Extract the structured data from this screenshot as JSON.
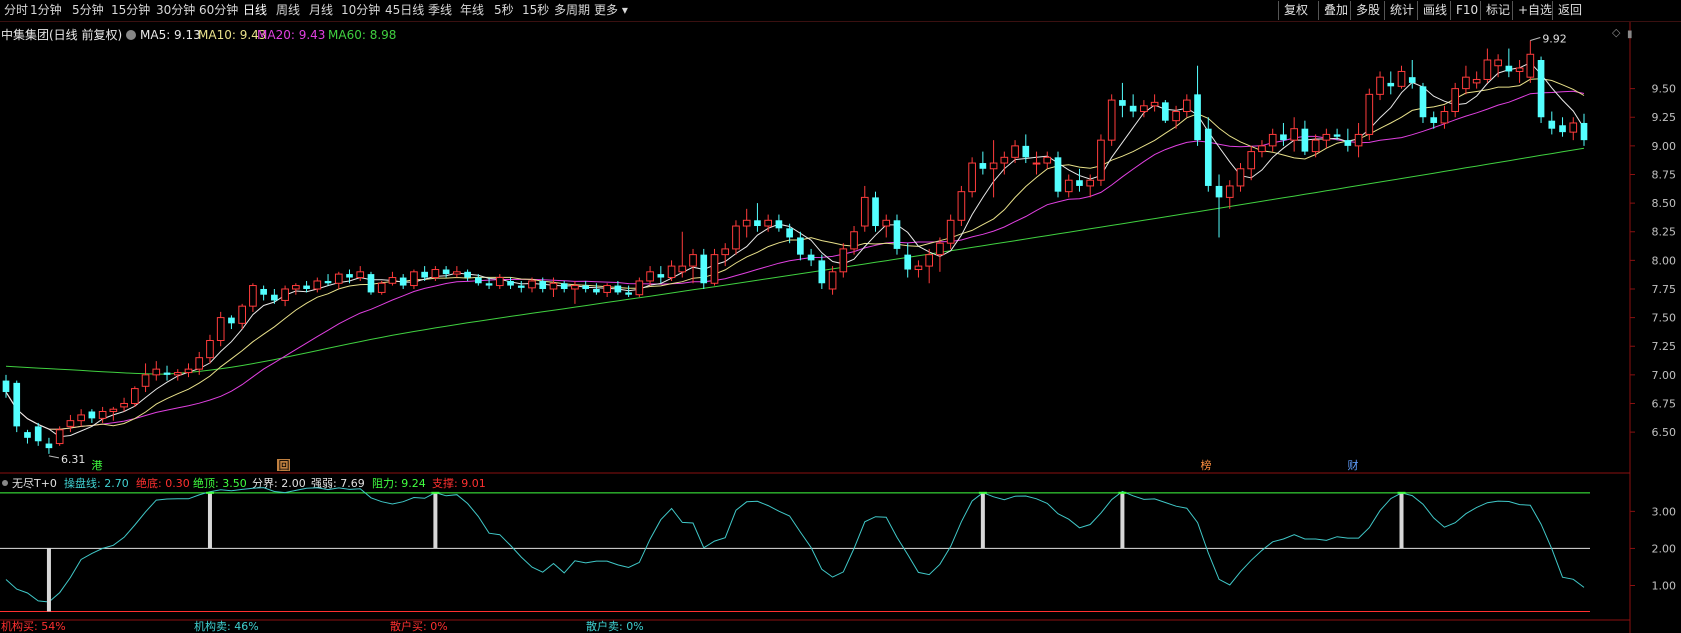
{
  "toolbar": {
    "periods": [
      "分时",
      "1分钟",
      "5分钟",
      "15分钟",
      "30分钟",
      "60分钟",
      "日线",
      "周线",
      "月线",
      "10分钟",
      "45日线",
      "季线",
      "年线",
      "5秒",
      "15秒",
      "多周期",
      "更多"
    ],
    "active_period": "日线",
    "right_buttons": [
      "复权",
      "叠加",
      "多股",
      "统计",
      "画线",
      "F10",
      "标记",
      "+自选",
      "返回"
    ]
  },
  "title": {
    "stock": "中集集团(日线 前复权)",
    "ma": [
      {
        "label": "MA5: 9.13",
        "color": "#e8e8e8"
      },
      {
        "label": "MA10: 9.43",
        "color": "#e8e08a"
      },
      {
        "label": "MA20: 9.43",
        "color": "#e040e0"
      },
      {
        "label": "MA60: 8.98",
        "color": "#40d040"
      }
    ]
  },
  "price_axis": [
    "9.50",
    "9.25",
    "9.00",
    "8.75",
    "8.50",
    "8.25",
    "8.00",
    "7.75",
    "7.50",
    "7.25",
    "7.00",
    "6.75",
    "6.50"
  ],
  "annotations": {
    "high": "9.92",
    "low": "6.31"
  },
  "event_markers": [
    {
      "text": "港",
      "color": "#40ff40"
    },
    {
      "text": "回",
      "color": "#ffd080"
    },
    {
      "text": "榜",
      "color": "#ff9040"
    },
    {
      "text": "财",
      "color": "#60a0ff"
    }
  ],
  "indicator": {
    "name": "无尽T+0",
    "values": [
      {
        "label": "操盘线: 2.70",
        "color": "#40d0d0"
      },
      {
        "label": "绝底: 0.30",
        "color": "#ff3030"
      },
      {
        "label": "绝顶: 3.50",
        "color": "#40ff40"
      },
      {
        "label": "分界: 2.00",
        "color": "#e0e0e0"
      },
      {
        "label": "强弱: 7.69",
        "color": "#e0e0e0"
      },
      {
        "label": "阻力: 9.24",
        "color": "#40ff40"
      },
      {
        "label": "支撑: 9.01",
        "color": "#ff3030"
      }
    ],
    "axis": [
      "3.00",
      "2.00",
      "1.00"
    ]
  },
  "footer": [
    {
      "text": "机构买: 54%",
      "color": "#ff3030"
    },
    {
      "text": "机构卖: 46%",
      "color": "#40d0d0"
    },
    {
      "text": "散户买: 0%",
      "color": "#ff3030"
    },
    {
      "text": "散户卖: 0%",
      "color": "#40d0d0"
    }
  ],
  "chart_data": {
    "type": "candlestick",
    "dates_shown": false,
    "ylim": [
      6.25,
      10.0
    ],
    "candles": [
      [
        6.95,
        7.0,
        6.8,
        6.85
      ],
      [
        6.93,
        6.95,
        6.5,
        6.55
      ],
      [
        6.5,
        6.52,
        6.4,
        6.45
      ],
      [
        6.55,
        6.58,
        6.38,
        6.42
      ],
      [
        6.4,
        6.45,
        6.31,
        6.36
      ],
      [
        6.4,
        6.55,
        6.38,
        6.52
      ],
      [
        6.55,
        6.65,
        6.5,
        6.6
      ],
      [
        6.6,
        6.7,
        6.55,
        6.65
      ],
      [
        6.68,
        6.7,
        6.58,
        6.62
      ],
      [
        6.62,
        6.72,
        6.58,
        6.68
      ],
      [
        6.68,
        6.72,
        6.6,
        6.7
      ],
      [
        6.72,
        6.8,
        6.68,
        6.75
      ],
      [
        6.75,
        6.9,
        6.72,
        6.88
      ],
      [
        6.9,
        7.1,
        6.85,
        7.0
      ],
      [
        7.0,
        7.12,
        6.95,
        7.05
      ],
      [
        7.02,
        7.08,
        6.95,
        7.0
      ],
      [
        7.0,
        7.05,
        6.95,
        7.02
      ],
      [
        7.02,
        7.1,
        6.98,
        7.05
      ],
      [
        7.05,
        7.2,
        7.0,
        7.15
      ],
      [
        7.15,
        7.35,
        7.1,
        7.3
      ],
      [
        7.3,
        7.55,
        7.25,
        7.5
      ],
      [
        7.5,
        7.52,
        7.4,
        7.45
      ],
      [
        7.45,
        7.62,
        7.4,
        7.6
      ],
      [
        7.6,
        7.8,
        7.55,
        7.78
      ],
      [
        7.75,
        7.78,
        7.65,
        7.7
      ],
      [
        7.7,
        7.75,
        7.62,
        7.65
      ],
      [
        7.65,
        7.78,
        7.6,
        7.75
      ],
      [
        7.75,
        7.8,
        7.7,
        7.78
      ],
      [
        7.78,
        7.82,
        7.72,
        7.75
      ],
      [
        7.75,
        7.85,
        7.72,
        7.82
      ],
      [
        7.82,
        7.88,
        7.78,
        7.8
      ],
      [
        7.8,
        7.9,
        7.75,
        7.88
      ],
      [
        7.88,
        7.92,
        7.8,
        7.85
      ],
      [
        7.85,
        7.95,
        7.82,
        7.9
      ],
      [
        7.88,
        7.9,
        7.7,
        7.72
      ],
      [
        7.72,
        7.82,
        7.7,
        7.8
      ],
      [
        7.8,
        7.9,
        7.78,
        7.85
      ],
      [
        7.85,
        7.88,
        7.75,
        7.78
      ],
      [
        7.78,
        7.92,
        7.75,
        7.9
      ],
      [
        7.9,
        7.95,
        7.82,
        7.85
      ],
      [
        7.85,
        7.95,
        7.82,
        7.92
      ],
      [
        7.92,
        7.95,
        7.85,
        7.88
      ],
      [
        7.88,
        7.95,
        7.85,
        7.9
      ],
      [
        7.9,
        7.92,
        7.82,
        7.85
      ],
      [
        7.85,
        7.88,
        7.78,
        7.8
      ],
      [
        7.8,
        7.85,
        7.75,
        7.78
      ],
      [
        7.78,
        7.88,
        7.75,
        7.85
      ],
      [
        7.82,
        7.85,
        7.75,
        7.78
      ],
      [
        7.78,
        7.82,
        7.72,
        7.76
      ],
      [
        7.76,
        7.85,
        7.72,
        7.82
      ],
      [
        7.82,
        7.85,
        7.72,
        7.75
      ],
      [
        7.75,
        7.85,
        7.68,
        7.8
      ],
      [
        7.8,
        7.82,
        7.72,
        7.75
      ],
      [
        7.75,
        7.82,
        7.62,
        7.78
      ],
      [
        7.78,
        7.82,
        7.72,
        7.75
      ],
      [
        7.75,
        7.8,
        7.7,
        7.72
      ],
      [
        7.72,
        7.8,
        7.68,
        7.78
      ],
      [
        7.78,
        7.82,
        7.7,
        7.72
      ],
      [
        7.72,
        7.78,
        7.68,
        7.7
      ],
      [
        7.7,
        7.85,
        7.68,
        7.82
      ],
      [
        7.82,
        7.95,
        7.78,
        7.9
      ],
      [
        7.88,
        7.95,
        7.8,
        7.85
      ],
      [
        7.85,
        8.0,
        7.82,
        7.95
      ],
      [
        7.9,
        8.25,
        7.85,
        7.95
      ],
      [
        7.95,
        8.1,
        7.8,
        8.05
      ],
      [
        8.05,
        8.1,
        7.75,
        7.8
      ],
      [
        7.8,
        8.1,
        7.78,
        8.05
      ],
      [
        8.05,
        8.15,
        7.95,
        8.1
      ],
      [
        8.1,
        8.35,
        8.05,
        8.3
      ],
      [
        8.3,
        8.45,
        8.2,
        8.35
      ],
      [
        8.35,
        8.5,
        8.25,
        8.3
      ],
      [
        8.3,
        8.4,
        8.25,
        8.35
      ],
      [
        8.35,
        8.4,
        8.25,
        8.28
      ],
      [
        8.28,
        8.32,
        8.15,
        8.2
      ],
      [
        8.2,
        8.25,
        8.0,
        8.05
      ],
      [
        8.05,
        8.1,
        7.95,
        8.0
      ],
      [
        8.0,
        8.05,
        7.75,
        7.8
      ],
      [
        7.75,
        7.95,
        7.7,
        7.9
      ],
      [
        7.9,
        8.15,
        7.85,
        8.1
      ],
      [
        8.1,
        8.3,
        8.05,
        8.25
      ],
      [
        8.3,
        8.65,
        8.25,
        8.55
      ],
      [
        8.55,
        8.6,
        8.25,
        8.3
      ],
      [
        8.3,
        8.4,
        8.2,
        8.35
      ],
      [
        8.35,
        8.4,
        8.05,
        8.1
      ],
      [
        8.05,
        8.15,
        7.85,
        7.92
      ],
      [
        7.92,
        8.0,
        7.85,
        7.95
      ],
      [
        7.95,
        8.1,
        7.8,
        8.05
      ],
      [
        8.05,
        8.2,
        7.9,
        8.15
      ],
      [
        8.15,
        8.4,
        8.1,
        8.35
      ],
      [
        8.35,
        8.65,
        8.3,
        8.6
      ],
      [
        8.6,
        8.9,
        8.55,
        8.85
      ],
      [
        8.85,
        8.95,
        8.75,
        8.8
      ],
      [
        8.8,
        9.05,
        8.55,
        8.85
      ],
      [
        8.85,
        8.95,
        8.75,
        8.9
      ],
      [
        8.9,
        9.05,
        8.85,
        9.0
      ],
      [
        9.0,
        9.1,
        8.85,
        8.9
      ],
      [
        8.85,
        8.95,
        8.75,
        8.85
      ],
      [
        8.85,
        8.95,
        8.8,
        8.9
      ],
      [
        8.9,
        8.95,
        8.55,
        8.6
      ],
      [
        8.6,
        8.75,
        8.55,
        8.7
      ],
      [
        8.7,
        8.8,
        8.6,
        8.65
      ],
      [
        8.65,
        8.75,
        8.55,
        8.7
      ],
      [
        8.7,
        9.1,
        8.65,
        9.05
      ],
      [
        9.05,
        9.45,
        9.0,
        9.4
      ],
      [
        9.4,
        9.55,
        9.25,
        9.35
      ],
      [
        9.35,
        9.45,
        9.25,
        9.3
      ],
      [
        9.3,
        9.4,
        9.25,
        9.35
      ],
      [
        9.35,
        9.45,
        9.3,
        9.38
      ],
      [
        9.38,
        9.4,
        9.2,
        9.22
      ],
      [
        9.22,
        9.35,
        9.15,
        9.3
      ],
      [
        9.3,
        9.45,
        9.25,
        9.4
      ],
      [
        9.45,
        9.7,
        9.0,
        9.05
      ],
      [
        9.15,
        9.25,
        8.6,
        8.65
      ],
      [
        8.65,
        8.75,
        8.2,
        8.55
      ],
      [
        8.55,
        8.7,
        8.45,
        8.65
      ],
      [
        8.65,
        8.85,
        8.6,
        8.8
      ],
      [
        8.8,
        9.0,
        8.7,
        8.95
      ],
      [
        8.95,
        9.05,
        8.9,
        9.0
      ],
      [
        9.0,
        9.15,
        8.95,
        9.1
      ],
      [
        9.1,
        9.2,
        9.0,
        9.05
      ],
      [
        9.05,
        9.25,
        8.95,
        9.15
      ],
      [
        9.15,
        9.22,
        8.92,
        8.95
      ],
      [
        8.95,
        9.1,
        8.9,
        9.05
      ],
      [
        9.05,
        9.15,
        8.98,
        9.1
      ],
      [
        9.1,
        9.15,
        9.05,
        9.08
      ],
      [
        9.05,
        9.15,
        8.95,
        9.0
      ],
      [
        9.0,
        9.2,
        8.9,
        9.1
      ],
      [
        9.1,
        9.5,
        9.05,
        9.45
      ],
      [
        9.45,
        9.65,
        9.4,
        9.6
      ],
      [
        9.55,
        9.65,
        9.45,
        9.52
      ],
      [
        9.52,
        9.7,
        9.5,
        9.65
      ],
      [
        9.6,
        9.75,
        9.5,
        9.55
      ],
      [
        9.52,
        9.55,
        9.2,
        9.25
      ],
      [
        9.25,
        9.3,
        9.15,
        9.2
      ],
      [
        9.2,
        9.35,
        9.15,
        9.3
      ],
      [
        9.3,
        9.55,
        9.25,
        9.5
      ],
      [
        9.5,
        9.7,
        9.45,
        9.6
      ],
      [
        9.55,
        9.65,
        9.5,
        9.58
      ],
      [
        9.58,
        9.85,
        9.55,
        9.75
      ],
      [
        9.7,
        9.8,
        9.6,
        9.75
      ],
      [
        9.7,
        9.85,
        9.6,
        9.65
      ],
      [
        9.65,
        9.75,
        9.55,
        9.68
      ],
      [
        9.6,
        9.92,
        9.55,
        9.8
      ],
      [
        9.75,
        9.78,
        9.2,
        9.25
      ],
      [
        9.22,
        9.3,
        9.1,
        9.15
      ],
      [
        9.18,
        9.25,
        9.08,
        9.12
      ],
      [
        9.12,
        9.25,
        9.05,
        9.2
      ],
      [
        9.2,
        9.28,
        9.0,
        9.05
      ]
    ],
    "ma60_range": [
      6.97,
      8.98
    ],
    "oscillator_range": [
      0.3,
      3.75
    ]
  }
}
